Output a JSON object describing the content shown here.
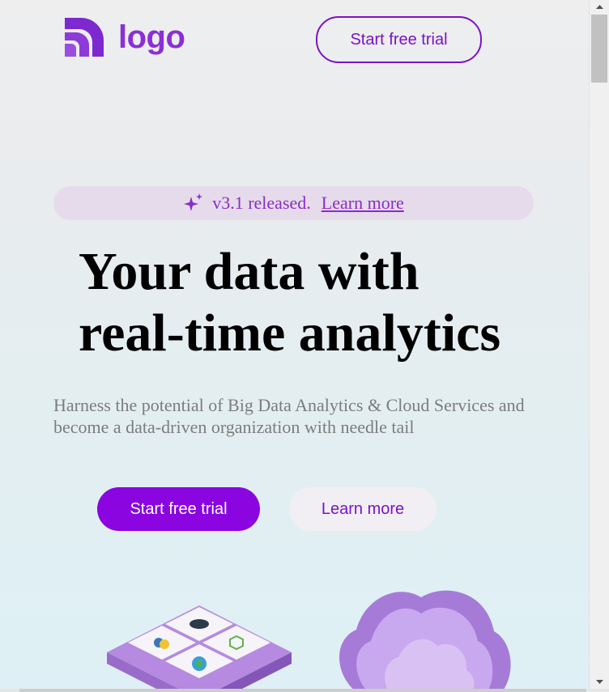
{
  "header": {
    "logo_text": "logo",
    "cta_label": "Start free trial"
  },
  "banner": {
    "icon": "sparkle-icon",
    "text": "v3.1 released.",
    "link_label": "Learn more"
  },
  "hero": {
    "headline_line1": "Your data with",
    "headline_line2": "real-time analytics",
    "subtext": "Harness the potential of Big Data Analytics & Cloud Services and become a data-driven organization with needle tail",
    "primary_cta": "Start free trial",
    "secondary_cta": "Learn more"
  },
  "colors": {
    "brand": "#8a05e0",
    "brand_text": "#7a12c9",
    "banner_bg": "#e6dbea"
  }
}
